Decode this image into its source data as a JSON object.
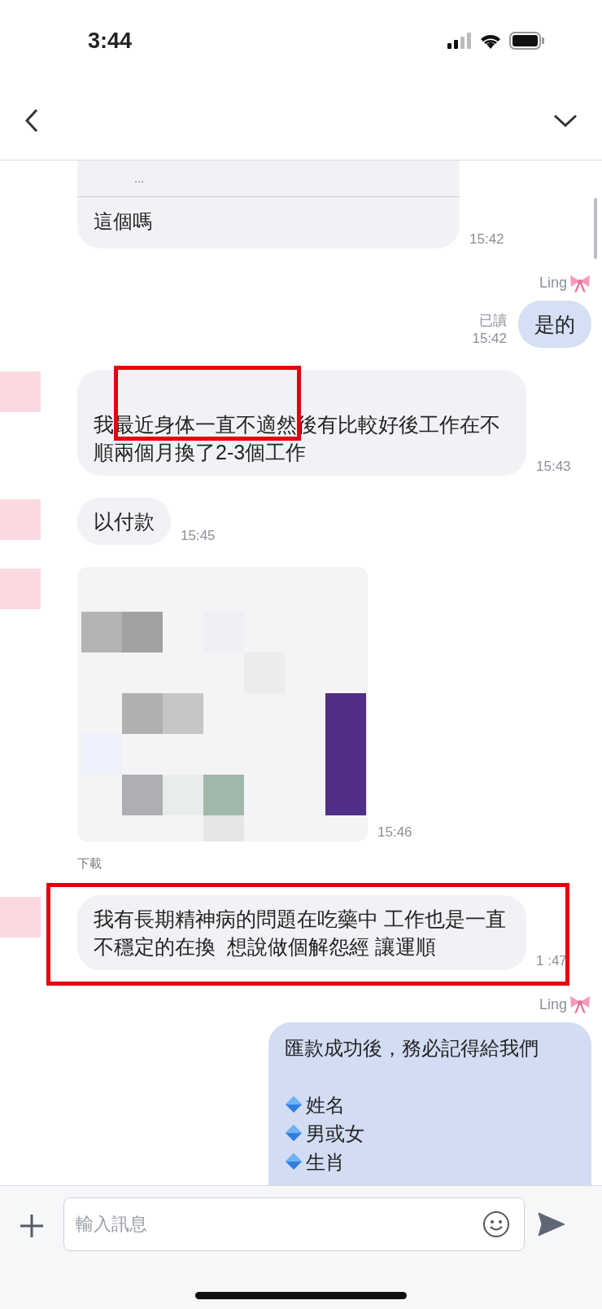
{
  "status_bar": {
    "time": "3:44"
  },
  "messages": [
    {
      "kind": "quote",
      "outgoing": false,
      "quote": "...",
      "text": "這個嗎",
      "time": "15:42"
    },
    {
      "kind": "text",
      "outgoing": true,
      "sender": "Ling",
      "text": "是的",
      "read": "已讀",
      "time": "15:42"
    },
    {
      "kind": "text",
      "outgoing": false,
      "text": "我最近身体一直不適然後有比較好後工作在不順兩個月換了2-3個工作",
      "time": "15:43",
      "text_highlighted": true,
      "bubble_highlighted": false
    },
    {
      "kind": "text",
      "outgoing": false,
      "text": "以付款",
      "time": "15:45"
    },
    {
      "outgoing": false,
      "time": "15:46",
      "download": "下載"
    },
    {
      "kind": "text",
      "outgoing": false,
      "text": "我有長期精神病的問題在吃藥中 工作也是一直不穩定的在換  想說做個解怨經 讓運順",
      "time": "1 :47",
      "text_highlighted": false,
      "bubble_highlighted": true
    },
    {
      "kind": "list",
      "outgoing": true,
      "sender": "Ling",
      "text": "匯款成功後，務必記得給我們",
      "items": [
        "姓名",
        "男或女",
        "生肖"
      ]
    }
  ],
  "composer": {
    "placeholder": "輸入訊息"
  }
}
